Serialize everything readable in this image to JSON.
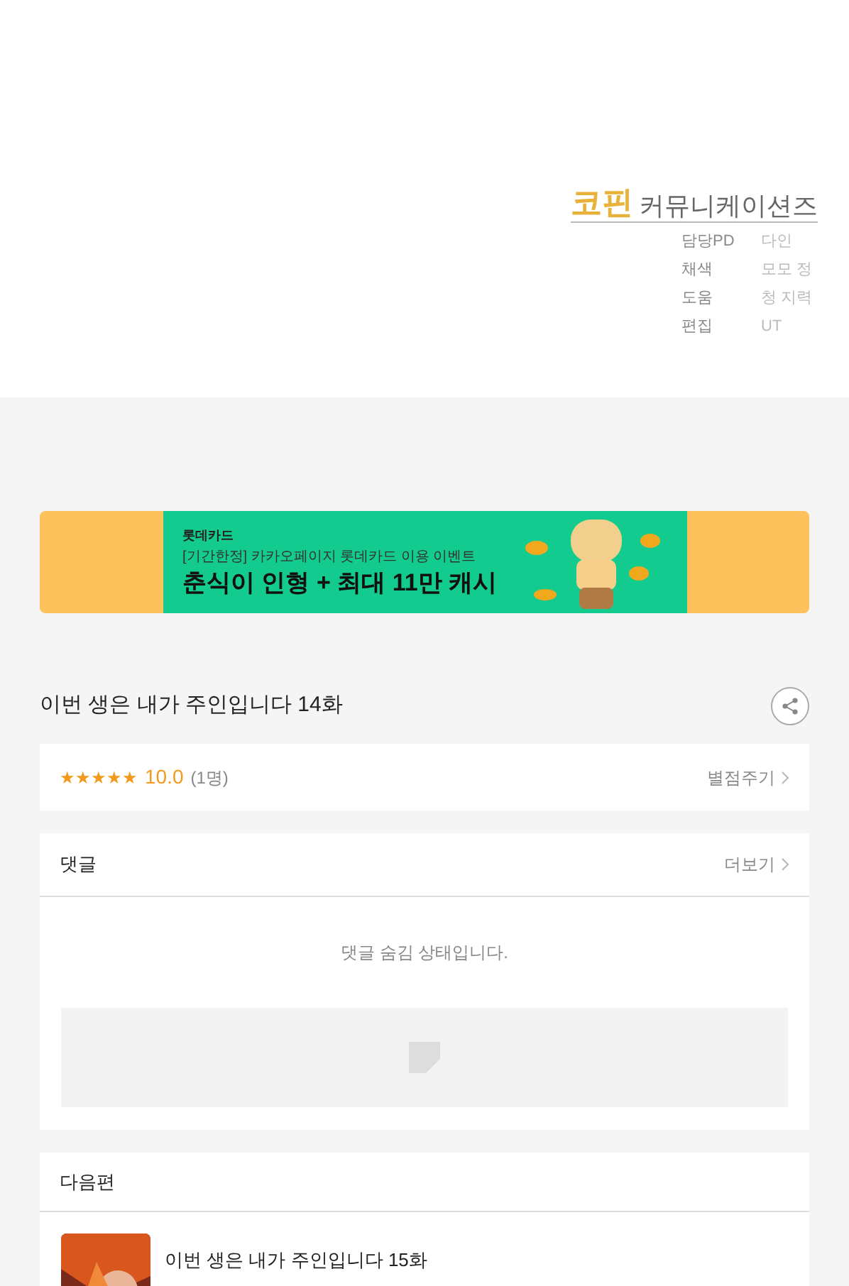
{
  "credits": {
    "brand": "코핀",
    "company": "커뮤니케이션즈",
    "rows": [
      {
        "role": "담당PD",
        "name": "다인"
      },
      {
        "role": "채색",
        "name": "모모 정"
      },
      {
        "role": "도움",
        "name": "청 지력"
      },
      {
        "role": "편집",
        "name": "UT"
      }
    ]
  },
  "banner": {
    "brand": "롯데카드",
    "subtitle": "[기간한정] 카카오페이지 롯데카드 이용 이벤트",
    "headline": "춘식이 인형 + 최대 11만 캐시"
  },
  "episode": {
    "title": "이번 생은 내가 주인입니다 14화"
  },
  "rating": {
    "stars": 5,
    "score": "10.0",
    "count": "(1명)",
    "action": "별점주기"
  },
  "comments": {
    "title": "댓글",
    "more": "더보기",
    "message": "댓글 숨김 상태입니다."
  },
  "next": {
    "title": "다음편",
    "item": {
      "title": "이번 생은 내가 주인입니다 15화"
    }
  }
}
